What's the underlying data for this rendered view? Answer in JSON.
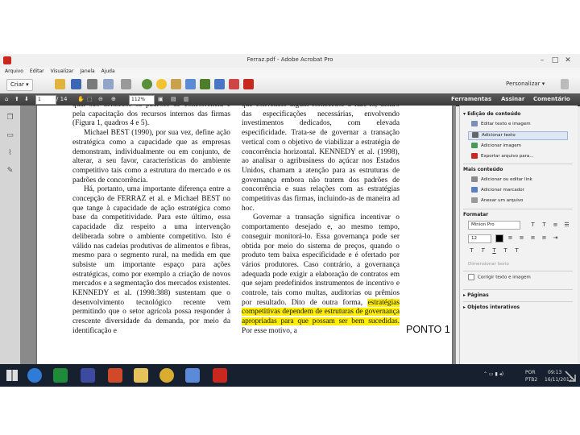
{
  "window": {
    "title": "Ferraz.pdf - Adobe Acrobat Pro"
  },
  "menu": [
    "Arquivo",
    "Editar",
    "Visualizar",
    "Janela",
    "Ajuda"
  ],
  "toolbar": {
    "create_label": "Criar ▾",
    "customize_label": "Personalizar ▾"
  },
  "navigation": {
    "page_current": "1",
    "page_total": "/ 14",
    "zoom": "112%"
  },
  "tabs": [
    "Ferramentas",
    "Assinar",
    "Comentário"
  ],
  "document": {
    "left_column": [
      "qual são definidos os padrões de concorrência e pela capacitação dos recursos internos das firmas (Figura 1, quadros 4 e 5).",
      "Michael BEST (1990), por sua vez, define ação estratégica como a capacidade que as empresas demonstram, individualmente ou em conjunto, de alterar, a seu favor, características do ambiente competitivo tais como a estrutura do mercado e os padrões de concorrência.",
      "Há, portanto, uma importante diferença entre a concepção de FERRAZ et al. e Michael BEST no que tange à capacidade de ação estratégica como base da competitividade. Para este último, essa capacidade diz respeito a uma intervenção deliberada sobre o ambiente competitivo. Isto é válido nas cadeias produtivas de alimentos e fibras, mesmo para o segmento rural, na medida em que subsiste um importante espaço para ações estratégicas, como por exemplo a criação de novos mercados e a segmentação dos mercados existentes. KENNEDY et al. (1998:388) sustentam que o desenvolvimento tecnológico recente vem permitindo que o setor agrícola possa responder à crescente diversidade da demanda, por meio da identificação e"
    ],
    "right_column": [
      "que convencer algum fornecedor a fazê-lo, dentro das especificações necessárias, envolvendo investimentos dedicados, com elevada especificidade. Trata-se de governar a transação vertical com o objetivo de viabilizar a estratégia de concorrência horizontal. KENNEDY et al. (1998), ao analisar o agribusiness do açúcar nos Estados Unidos, chamam a atenção para as estruturas de governança embora não tratem dos padrões de concorrência e suas relações com as estratégias competitivas das firmas, incluindo-as de maneira ad hoc.",
      "Governar a transação significa incentivar o comportamento desejado e, ao mesmo tempo, conseguir monitorá-lo. Essa governança pode ser obtida por meio do sistema de preços, quando o produto tem baixa especificidade e é ofertado por vários produtores. Caso contrário, a governança adequada pode exigir a elaboração de contratos em que sejam predefinidos instrumentos de incentivo e controle, tais como multas, auditorias ou prêmios por resultado. Dito de outra forma,",
      "estratégias competitivas dependem de estruturas de governança apropriadas para que possam ser bem sucedidas.",
      " Por esse motivo, a"
    ]
  },
  "panel": {
    "edit_section": "Edição de conteúdo",
    "edit_items": [
      "Editar texto e imagem",
      "Adicionar texto",
      "Adicionar imagem",
      "Exportar arquivo para..."
    ],
    "more_section": "Mais conteúdo",
    "more_items": [
      "Adicionar ou editar link",
      "Adicionar marcador",
      "Anexar um arquivo"
    ],
    "format_section": "Formatar",
    "font_value": "Minion Pro",
    "size_value": "12",
    "scale_label": "Dimensionar texto",
    "fix_label": "Corrigir texto e imagem",
    "pages_section": "Páginas",
    "interactive_section": "Objetos interativos"
  },
  "taskbar": {
    "lang": "POR",
    "region": "PTB2",
    "time": "09:13",
    "date": "16/11/2017"
  },
  "annotation": {
    "text": "PONTO 1"
  },
  "colors": {
    "highlight": "#ffee00",
    "taskbar": "#16202e",
    "acrobat_red": "#c8281e"
  }
}
